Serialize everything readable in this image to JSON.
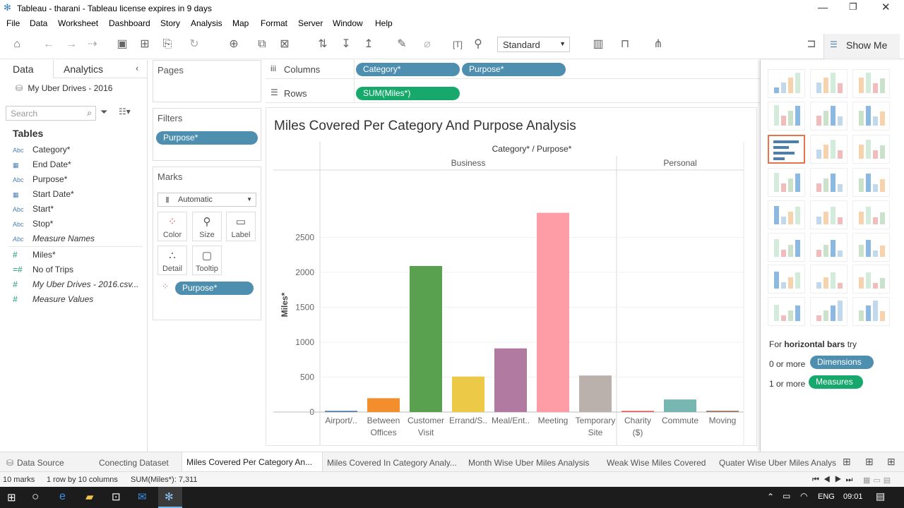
{
  "window": {
    "title": "Tableau - tharani - Tableau license expires in 9 days"
  },
  "menu": [
    "File",
    "Data",
    "Worksheet",
    "Dashboard",
    "Story",
    "Analysis",
    "Map",
    "Format",
    "Server",
    "Window",
    "Help"
  ],
  "toolbar": {
    "fit_select": "Standard",
    "show_me_label": "Show Me"
  },
  "leftpane": {
    "tab_data": "Data",
    "tab_analytics": "Analytics",
    "datasource": "My Uber Drives - 2016",
    "search_placeholder": "Search",
    "tables_heading": "Tables",
    "fields": [
      {
        "type": "Abc",
        "name": "Category*"
      },
      {
        "type": "cal",
        "name": "End Date*"
      },
      {
        "type": "Abc",
        "name": "Purpose*"
      },
      {
        "type": "cal",
        "name": "Start Date*"
      },
      {
        "type": "Abc",
        "name": "Start*"
      },
      {
        "type": "Abc",
        "name": "Stop*"
      },
      {
        "type": "Abc",
        "name": "Measure Names"
      },
      {
        "type": "#",
        "name": "Miles*"
      },
      {
        "type": "#",
        "name": "No of Trips"
      },
      {
        "type": "#",
        "name": "My Uber Drives - 2016.csv..."
      },
      {
        "type": "#",
        "name": "Measure Values"
      }
    ]
  },
  "cards": {
    "pages": "Pages",
    "filters": "Filters",
    "filter_pill": "Purpose*",
    "marks": "Marks",
    "marks_type": "Automatic",
    "mark_buttons": [
      "Color",
      "Size",
      "Label",
      "Detail",
      "Tooltip"
    ],
    "marks_pill": "Purpose*"
  },
  "shelves": {
    "columns_label": "Columns",
    "rows_label": "Rows",
    "columns_pills": [
      "Category*",
      "Purpose*"
    ],
    "rows_pills": [
      "SUM(Miles*)"
    ]
  },
  "viz": {
    "title": "Miles Covered Per Category And Purpose Analysis",
    "header": "Category* / Purpose*",
    "panes": [
      "Business",
      "Personal"
    ]
  },
  "chart_data": {
    "type": "bar",
    "title": "Miles Covered Per Category And Purpose Analysis",
    "xlabel": "Category* / Purpose*",
    "ylabel": "Miles*",
    "groups": [
      "Business",
      "Personal"
    ],
    "categories": [
      {
        "group": "Business",
        "label": "Airport/..",
        "value": 17,
        "color": "#4e79a7"
      },
      {
        "group": "Business",
        "label": "Between Offices",
        "value": 198,
        "color": "#f28e2b"
      },
      {
        "group": "Business",
        "label": "Customer Visit",
        "value": 2090,
        "color": "#59a14f"
      },
      {
        "group": "Business",
        "label": "Errand/S..",
        "value": 508,
        "color": "#edc948"
      },
      {
        "group": "Business",
        "label": "Meal/Ent..",
        "value": 911,
        "color": "#b07aa1"
      },
      {
        "group": "Business",
        "label": "Meeting",
        "value": 2851,
        "color": "#ff9da7"
      },
      {
        "group": "Business",
        "label": "Temporary Site",
        "value": 523,
        "color": "#bab0ac"
      },
      {
        "group": "Personal",
        "label": "Charity ($)",
        "value": 16,
        "color": "#e15759"
      },
      {
        "group": "Personal",
        "label": "Commute",
        "value": 180,
        "color": "#76b7b2"
      },
      {
        "group": "Personal",
        "label": "Moving",
        "value": 18,
        "color": "#9c755f"
      }
    ],
    "yticks": [
      0,
      500,
      1000,
      1500,
      2000,
      2500
    ],
    "ylim": [
      0,
      3150
    ],
    "grid": true
  },
  "showme": {
    "hint_prefix": "For",
    "hint_bold": "horizontal bars",
    "hint_suffix": "try",
    "dim_count": "0 or more",
    "dim_label": "Dimensions",
    "mea_count": "1 or more",
    "mea_label": "Measures"
  },
  "sheet_tabs": [
    "Data Source",
    "Conecting Dataset",
    "Miles Covered Per Category An...",
    "Miles Covered In Category Analy...",
    "Month Wise Uber Miles Analysis",
    "Weak Wise Miles Covered",
    "Quater Wise Uber Miles Analys"
  ],
  "status": {
    "marks": "10 marks",
    "rows": "1 row by 10 columns",
    "sum": "SUM(Miles*): 7,311"
  },
  "taskbar": {
    "lang": "ENG",
    "time": "09:01"
  }
}
